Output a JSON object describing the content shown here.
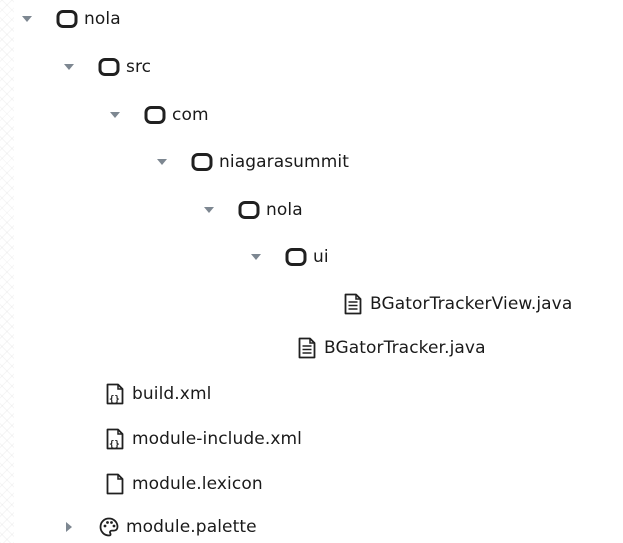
{
  "tree": {
    "nodes": [
      {
        "label": "nola",
        "icon": "folder-icon",
        "toggle": "expanded"
      },
      {
        "label": "src",
        "icon": "folder-icon",
        "toggle": "expanded"
      },
      {
        "label": "com",
        "icon": "folder-icon",
        "toggle": "expanded"
      },
      {
        "label": "niagarasummit",
        "icon": "folder-icon",
        "toggle": "expanded"
      },
      {
        "label": "nola",
        "icon": "folder-icon",
        "toggle": "expanded"
      },
      {
        "label": "ui",
        "icon": "folder-icon",
        "toggle": "expanded"
      },
      {
        "label": "BGatorTrackerView.java",
        "icon": "text-file-icon",
        "toggle": "none"
      },
      {
        "label": "BGatorTracker.java",
        "icon": "text-file-icon",
        "toggle": "none"
      },
      {
        "label": "build.xml",
        "icon": "xml-file-icon",
        "toggle": "none"
      },
      {
        "label": "module-include.xml",
        "icon": "xml-file-icon",
        "toggle": "none"
      },
      {
        "label": "module.lexicon",
        "icon": "blank-file-icon",
        "toggle": "none"
      },
      {
        "label": "module.palette",
        "icon": "palette-icon",
        "toggle": "collapsed"
      }
    ]
  }
}
